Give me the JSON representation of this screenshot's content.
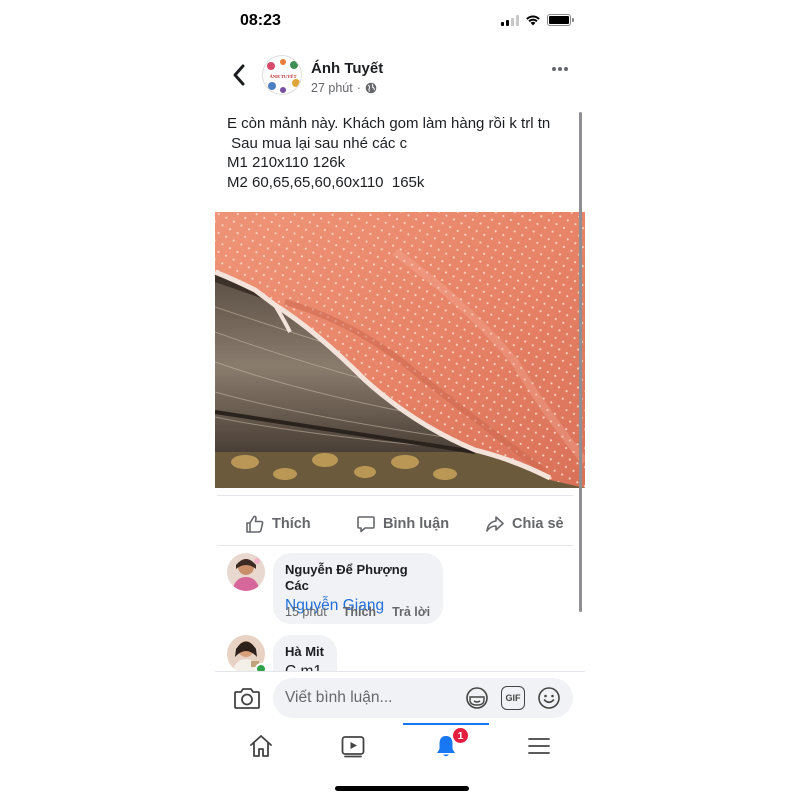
{
  "status_bar": {
    "time": "08:23"
  },
  "post": {
    "author": "Ánh Tuyết",
    "time_ago": "27 phút",
    "separator": "·",
    "privacy_icon": "globe-icon",
    "avatar_text": "ÁNH TUYẾT",
    "text_lines": [
      "E còn mảnh này. Khách gom làm hàng rồi k trl tn",
      " Sau mua lại sau nhé các c",
      "M1 210x110 126k",
      "M2 60,65,65,60,60x110  165k"
    ],
    "photo": "orange-dotted-fabric-on-wood"
  },
  "actions": {
    "like": "Thích",
    "comment": "Bình luận",
    "share": "Chia sẻ"
  },
  "comments": [
    {
      "author": "Nguyễn Để Phượng Các",
      "text": "Nguyễn Giang",
      "time": "15 phút",
      "like_label": "Thích",
      "reply_label": "Trả lời"
    },
    {
      "author": "Hà Mit",
      "text": "C m1"
    }
  ],
  "composer": {
    "placeholder": "Viết bình luận...",
    "gif_label": "GIF"
  },
  "bottom_nav": {
    "notifications_badge": "1",
    "items": [
      "home-icon",
      "video-icon",
      "bell-icon",
      "menu-icon"
    ]
  },
  "colors": {
    "accent": "#1877f2",
    "badge": "#e41e3f",
    "mention": "#216fdb",
    "secondary_text": "#65676b",
    "bubble": "#f0f2f5",
    "fabric": "#e98a6c"
  }
}
